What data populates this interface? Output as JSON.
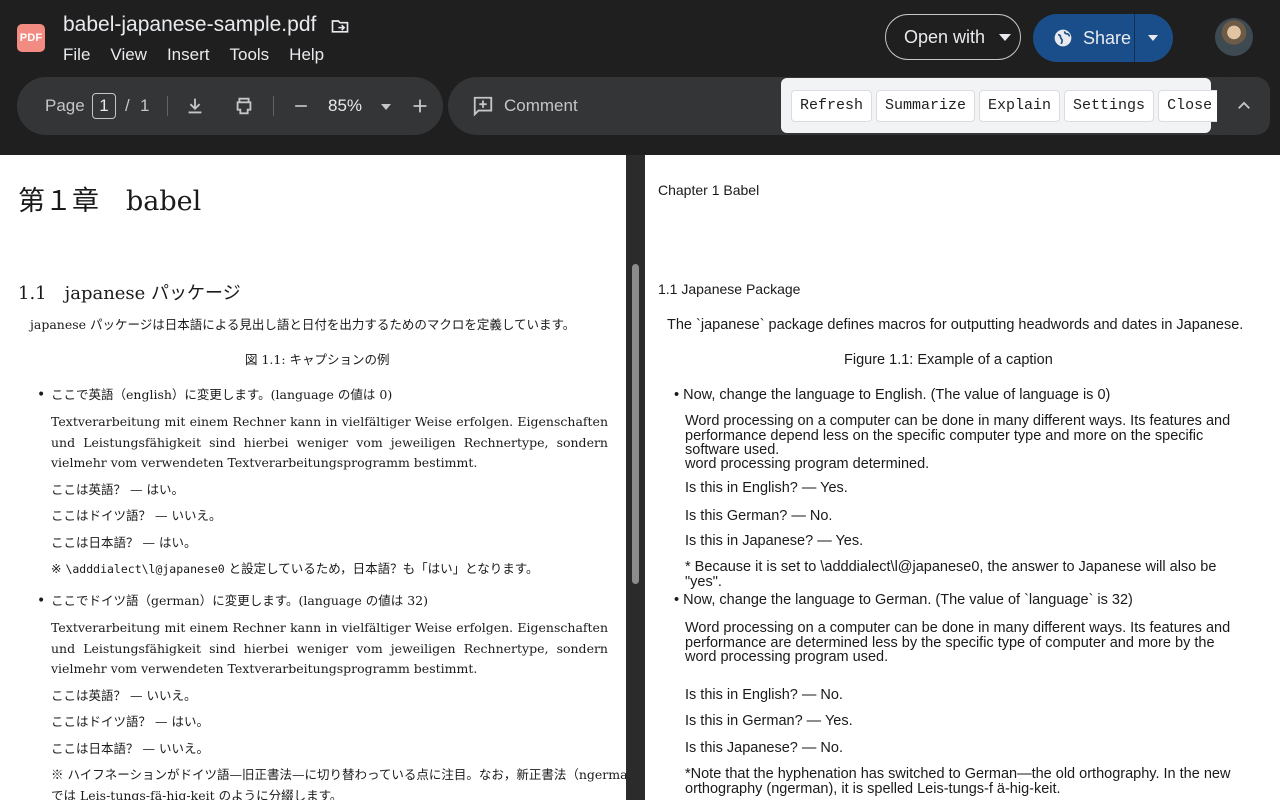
{
  "app": {
    "logo_text": "PDF",
    "file_name": "babel-japanese-sample.pdf",
    "menu": [
      "File",
      "View",
      "Insert",
      "Tools",
      "Help"
    ],
    "open_with_label": "Open with",
    "share_label": "Share"
  },
  "toolbar": {
    "page_label": "Page",
    "page_current": "1",
    "page_sep": "/",
    "page_total": "1",
    "zoom": "85%",
    "comment_label": "Comment",
    "actions": [
      "Refresh",
      "Summarize",
      "Explain",
      "Settings",
      "Close"
    ]
  },
  "left_doc": {
    "chapter": "第１章　babel",
    "section": "1.1　japanese パッケージ",
    "intro": "japanese パッケージは日本語による見出し語と日付を出力するためのマクロを定義しています。",
    "figure": "図 1.1: キャプションの例",
    "item1_head": "ここで英語（english）に変更します。(language の値は 0)",
    "item1_par": "Textverarbeitung mit einem Rechner kann in vielfältiger Weise erfolgen. Eigenschaften und Leistungsfähigkeit sind hierbei weniger vom jeweiligen Rechnertype, sondern vielmehr vom verwendeten Textverarbeitungsprogramm bestimmt.",
    "item1_q1": "ここは英語？ — はい。",
    "item1_q2": "ここはドイツ語？ — いいえ。",
    "item1_q3": "ここは日本語？ — はい。",
    "item1_note_a": "※ ",
    "item1_note_code": "\\adddialect\\l@japanese0",
    "item1_note_b": " と設定しているため，日本語？も「はい」となります。",
    "item2_head": "ここでドイツ語（german）に変更します。(language の値は 32)",
    "item2_par": "Textverarbeitung mit einem Rechner kann in vielfältiger Weise erfolgen. Eigenschaften und Leistungsfähigkeit sind hierbei weniger vom jeweiligen Rechnertype, sondern vielmehr vom verwendeten Textverarbeitungsprogramm bestimmt.",
    "item2_q1": "ここは英語？ — いいえ。",
    "item2_q2": "ここはドイツ語？ — はい。",
    "item2_q3": "ここは日本語？ — いいえ。",
    "item2_note_1": "※ ハイフネーションがドイツ語—旧正書法—に切り替わっている点に注目。なお，新正書法（ngerman）",
    "item2_note_2": "では Leis-tungs-fä-hig-keit のように分綴します。"
  },
  "right_doc": {
    "chapter": "Chapter 1 Babel",
    "section": "1.1 Japanese Package",
    "intro": "The `japanese` package defines macros for outputting headwords and dates in Japanese.",
    "figure": "Figure 1.1: Example of a caption",
    "item1_head": "Now, change the language to English. (The value of language is 0)",
    "item1_par": "Word processing on a computer can be done in many different ways. Its features and performance depend less on the specific computer type and more on the specific software used.",
    "item1_par_tail": "word processing program determined.",
    "item1_q1": "Is this in English? — Yes.",
    "item1_q2": "Is this German? — No.",
    "item1_q3": "Is this in Japanese? — Yes.",
    "item1_note": "* Because it is set to \\adddialect\\l@japanese0, the answer to Japanese will also be \"yes\".",
    "item2_head": "Now, change the language to German. (The value of `language` is 32)",
    "item2_par": "Word processing on a computer can be done in many different ways. Its features and performance are determined less by the specific type of computer and more by the word processing program used.",
    "item2_q1": "Is this in English? — No.",
    "item2_q2": "Is this in German? — Yes.",
    "item2_q3": "Is this Japanese? — No.",
    "item2_note": "*Note that the hyphenation has switched to German—the old orthography. In the new orthography (ngerman), it is spelled Leis-tungs-f ä-hig-keit."
  }
}
